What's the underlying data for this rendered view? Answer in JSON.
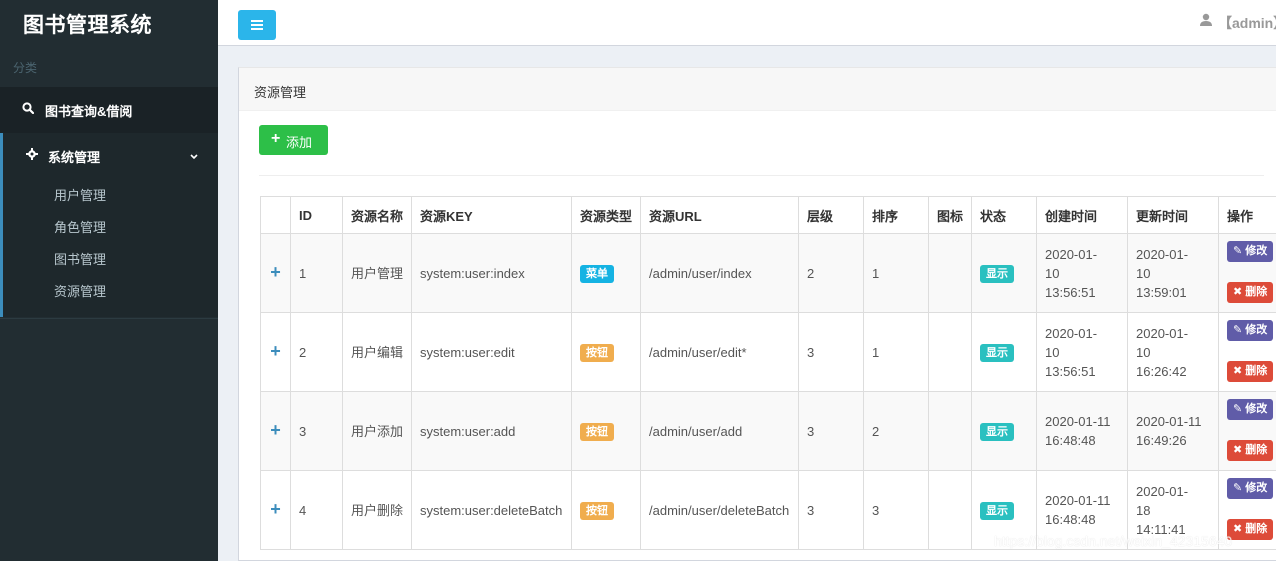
{
  "app": {
    "title": "图书管理系统"
  },
  "sidebar": {
    "section_header": "分类",
    "items": [
      {
        "label": "图书查询&借阅",
        "icon": "search-icon"
      },
      {
        "label": "系统管理",
        "icon": "gear-icon",
        "expanded": true,
        "children": [
          {
            "label": "用户管理"
          },
          {
            "label": "角色管理"
          },
          {
            "label": "图书管理"
          },
          {
            "label": "资源管理"
          }
        ]
      }
    ]
  },
  "header": {
    "user": "【admin】"
  },
  "main": {
    "box_title": "资源管理",
    "add_button": "添加",
    "table": {
      "columns": [
        "",
        "ID",
        "资源名称",
        "资源KEY",
        "资源类型",
        "资源URL",
        "层级",
        "排序",
        "图标",
        "状态",
        "创建时间",
        "更新时间",
        "操作"
      ],
      "rows": [
        {
          "id": "1",
          "name": "用户管理",
          "key": "system:user:index",
          "type": "菜单",
          "url": "/admin/user/index",
          "level": "2",
          "order": "1",
          "icon": "",
          "status": "显示",
          "created": "2020-01-10 13:56:51",
          "updated": "2020-01-10 13:59:01",
          "edit": "修改",
          "delete": "删除"
        },
        {
          "id": "2",
          "name": "用户编辑",
          "key": "system:user:edit",
          "type": "按钮",
          "url": "/admin/user/edit*",
          "level": "3",
          "order": "1",
          "icon": "",
          "status": "显示",
          "created": "2020-01-10 13:56:51",
          "updated": "2020-01-10 16:26:42",
          "edit": "修改",
          "delete": "删除"
        },
        {
          "id": "3",
          "name": "用户添加",
          "key": "system:user:add",
          "type": "按钮",
          "url": "/admin/user/add",
          "level": "3",
          "order": "2",
          "icon": "",
          "status": "显示",
          "created": "2020-01-11 16:48:48",
          "updated": "2020-01-11 16:49:26",
          "edit": "修改",
          "delete": "删除"
        },
        {
          "id": "4",
          "name": "用户删除",
          "key": "system:user:deleteBatch",
          "type": "按钮",
          "url": "/admin/user/deleteBatch",
          "level": "3",
          "order": "3",
          "icon": "",
          "status": "显示",
          "created": "2020-01-11 16:48:48",
          "updated": "2020-01-18 14:11:41",
          "edit": "修改",
          "delete": "删除"
        }
      ]
    }
  },
  "watermark": "https://blog.csdn.net/weixin_42315640",
  "colors": {
    "sidebar_bg": "#222d32",
    "toggle_btn": "#2bb5ea",
    "add_btn": "#2dbf48",
    "badge_menu": "#15b3e3",
    "badge_button": "#f0ad4e",
    "badge_show": "#2ac0c0",
    "edit_btn": "#605ca8",
    "delete_btn": "#dd4b39"
  }
}
